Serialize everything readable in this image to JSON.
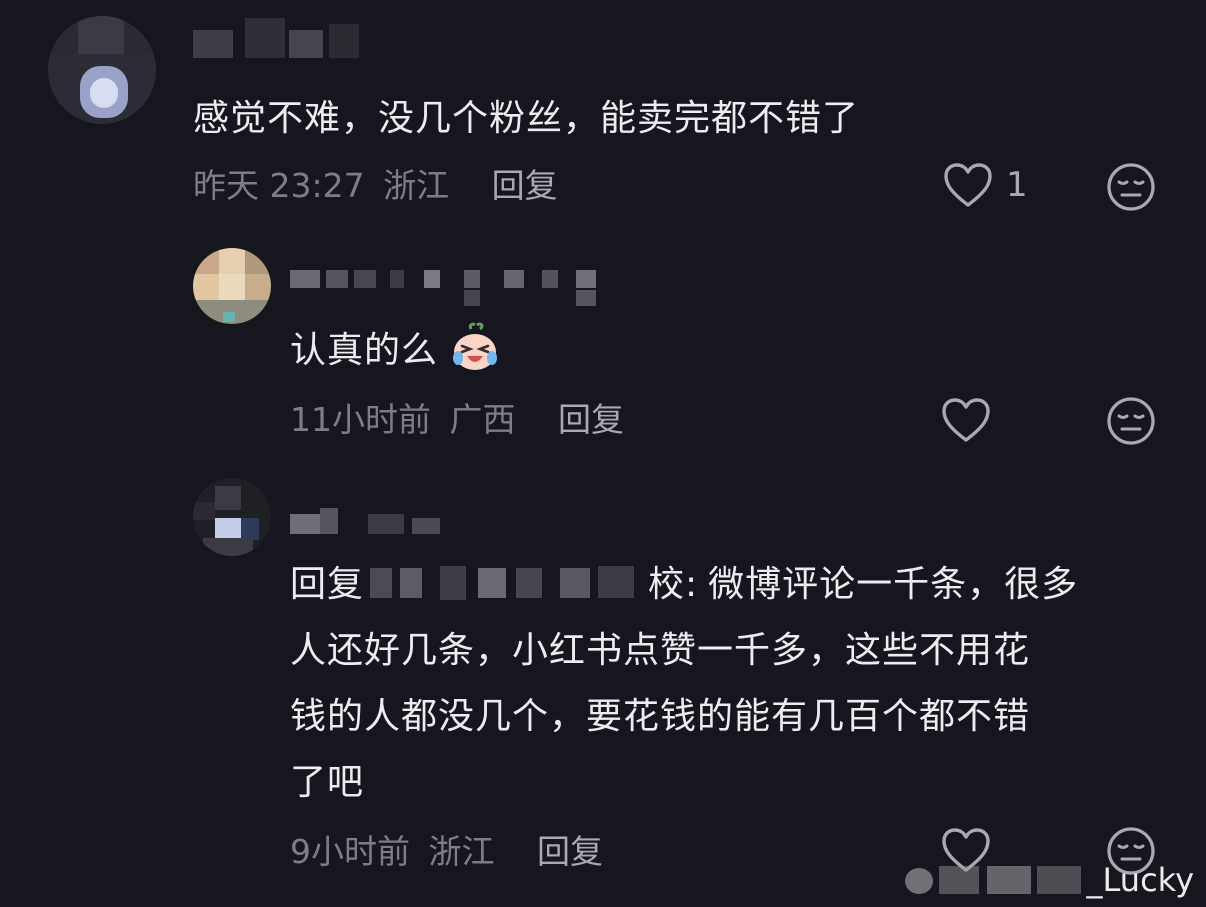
{
  "comments": [
    {
      "text": "感觉不难，没几个粉丝，能卖完都不错了",
      "time": "昨天 23:27",
      "location": "浙江",
      "reply_label": "回复",
      "like_count": "1"
    },
    {
      "text": "认真的么",
      "emoji": "crying-laughing",
      "time": "11小时前",
      "location": "广西",
      "reply_label": "回复",
      "like_count": ""
    },
    {
      "reply_prefix": "回复",
      "reply_target_tail": "校:",
      "text_lines": [
        "微博评论一千条，很多",
        "人还好几条，小红书点赞一千多，这些不用花",
        "钱的人都没几个，要花钱的能有几百个都不错",
        "了吧"
      ],
      "time": "9小时前",
      "location": "浙江",
      "reply_label": "回复",
      "like_count": ""
    }
  ],
  "watermark": {
    "text": "_Lucky"
  },
  "icons": {
    "like": "heart-outline-icon",
    "dislike": "unamused-face-icon"
  },
  "colors": {
    "background": "#16161e",
    "text": "#ececf1",
    "meta": "#7d7d86"
  }
}
